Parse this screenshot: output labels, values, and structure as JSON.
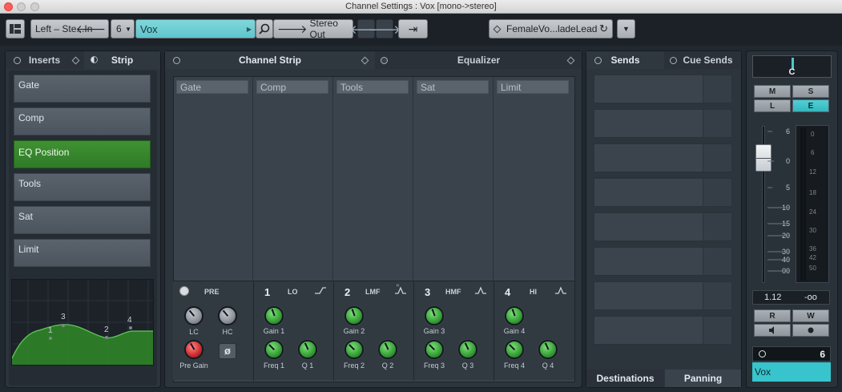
{
  "window": {
    "title": "Channel Settings : Vox [mono->stereo]"
  },
  "toolbar": {
    "input_routing": "Left – Ste...In",
    "channel_number": "6",
    "channel_name": "Vox",
    "output_routing": "Stereo Out",
    "preset_name": "FemaleVo...ladeLead"
  },
  "left_panel": {
    "tabs": [
      {
        "label": "Inserts"
      },
      {
        "label": "Strip"
      }
    ],
    "strip_items": [
      {
        "label": "Gate"
      },
      {
        "label": "Comp"
      },
      {
        "label": "EQ Position"
      },
      {
        "label": "Tools"
      },
      {
        "label": "Sat"
      },
      {
        "label": "Limit"
      }
    ],
    "eq_points": [
      "1",
      "3",
      "2",
      "4"
    ]
  },
  "center_panel": {
    "tabs": [
      {
        "label": "Channel Strip"
      },
      {
        "label": "Equalizer"
      }
    ],
    "modules": [
      {
        "label": "Gate"
      },
      {
        "label": "Comp"
      },
      {
        "label": "Tools"
      },
      {
        "label": "Sat"
      },
      {
        "label": "Limit"
      }
    ],
    "pre": {
      "label": "PRE",
      "lc_label": "LC",
      "hc_label": "HC",
      "pregain_label": "Pre Gain"
    },
    "bands": [
      {
        "num": "1",
        "name": "LO",
        "gain_label": "Gain 1",
        "freq_label": "Freq 1",
        "q_label": "Q 1"
      },
      {
        "num": "2",
        "name": "LMF",
        "gain_label": "Gain 2",
        "freq_label": "Freq 2",
        "q_label": "Q 2"
      },
      {
        "num": "3",
        "name": "HMF",
        "gain_label": "Gain 3",
        "freq_label": "Freq 3",
        "q_label": "Q 3"
      },
      {
        "num": "4",
        "name": "HI",
        "gain_label": "Gain 4",
        "freq_label": "Freq 4",
        "q_label": "Q 4"
      }
    ]
  },
  "sends_panel": {
    "tabs": [
      {
        "label": "Sends"
      },
      {
        "label": "Cue Sends"
      }
    ],
    "slot_count": 8,
    "bottom_tabs": [
      {
        "label": "Destinations"
      },
      {
        "label": "Panning"
      }
    ]
  },
  "fader_panel": {
    "pan": "C",
    "buttons": {
      "mute": "M",
      "solo": "S",
      "listen": "L",
      "edit": "E",
      "read": "R",
      "write": "W"
    },
    "fader_scale": [
      "6",
      "0",
      "5",
      "10",
      "15",
      "20",
      "30",
      "40",
      "00"
    ],
    "meter_scale": [
      "0",
      "6",
      "12",
      "18",
      "24",
      "30",
      "36",
      "42",
      "50"
    ],
    "fader_value": "1.12",
    "meter_value": "-oo",
    "channel_number": "6",
    "channel_name": "Vox"
  },
  "colors": {
    "accent_teal": "#5fc5cb",
    "active_green": "#2f7a27",
    "edit_teal": "#37b6bd",
    "pregain_red": "#d23030"
  }
}
